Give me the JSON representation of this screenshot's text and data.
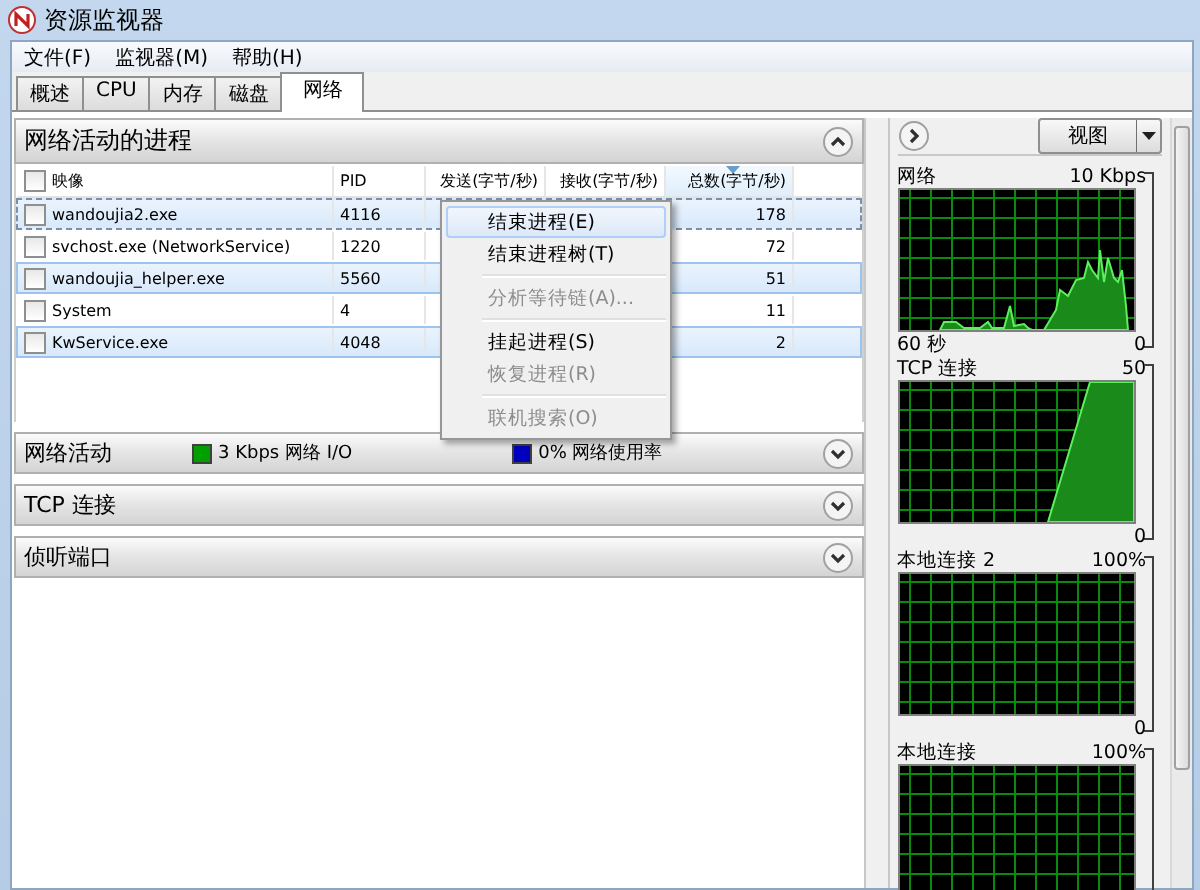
{
  "window": {
    "title": "资源监视器"
  },
  "menu_bar": [
    "文件(F)",
    "监视器(M)",
    "帮助(H)"
  ],
  "tabs": [
    {
      "label": "概述",
      "selected": false
    },
    {
      "label": "CPU",
      "selected": false
    },
    {
      "label": "内存",
      "selected": false
    },
    {
      "label": "磁盘",
      "selected": false
    },
    {
      "label": "网络",
      "selected": true
    }
  ],
  "sections": [
    {
      "title": "网络活动的进程",
      "expanded": true,
      "table": {
        "columns": [
          {
            "label": "映像",
            "sorted": false
          },
          {
            "label": "PID",
            "sorted": false
          },
          {
            "label": "发送(字节/秒)",
            "sorted": false
          },
          {
            "label": "接收(字节/秒)",
            "sorted": false
          },
          {
            "label": "总数(字节/秒)",
            "sorted": true
          }
        ],
        "rows": [
          {
            "image": "wandoujia2.exe",
            "pid": "4116",
            "total": "178",
            "checked": false,
            "selected": true
          },
          {
            "image": "svchost.exe (NetworkService)",
            "pid": "1220",
            "total": "72",
            "checked": false,
            "selected": false
          },
          {
            "image": "wandoujia_helper.exe",
            "pid": "5560",
            "total": "51",
            "checked": false,
            "selected": true
          },
          {
            "image": "System",
            "pid": "4",
            "total": "11",
            "checked": false,
            "selected": false
          },
          {
            "image": "KwService.exe",
            "pid": "4048",
            "total": "2",
            "checked": false,
            "selected": true
          }
        ]
      }
    },
    {
      "title": "网络活动",
      "expanded": false,
      "legend": [
        {
          "text": "3 Kbps 网络 I/O",
          "color": "#00a000"
        },
        {
          "text": "0% 网络使用率",
          "color": "#0000c0"
        }
      ]
    },
    {
      "title": "TCP 连接",
      "expanded": false
    },
    {
      "title": "侦听端口",
      "expanded": false
    }
  ],
  "context_menu": {
    "items": [
      {
        "kind": "item",
        "label": "结束进程(E)",
        "disabled": false,
        "selected": true
      },
      {
        "kind": "item",
        "label": "结束进程树(T)",
        "disabled": false,
        "selected": false
      },
      {
        "kind": "separator"
      },
      {
        "kind": "item",
        "label": "分析等待链(A)...",
        "disabled": true,
        "selected": false
      },
      {
        "kind": "separator"
      },
      {
        "kind": "item",
        "label": "挂起进程(S)",
        "disabled": false,
        "selected": false
      },
      {
        "kind": "item",
        "label": "恢复进程(R)",
        "disabled": true,
        "selected": false
      },
      {
        "kind": "separator"
      },
      {
        "kind": "item",
        "label": "联机搜索(O)",
        "disabled": true,
        "selected": false
      }
    ]
  },
  "side_panel": {
    "view_button": "视图",
    "graphs": [
      {
        "title": "网络",
        "max": "10 Kbps",
        "time": "60 秒",
        "min": "0",
        "kind": "burst"
      },
      {
        "title": "TCP 连接",
        "max": "50",
        "min": "0",
        "kind": "ramp"
      },
      {
        "title": "本地连接 2",
        "max": "100%",
        "min": "0",
        "kind": "idle"
      },
      {
        "title": "本地连接",
        "max": "100%",
        "kind": "idle"
      }
    ]
  }
}
